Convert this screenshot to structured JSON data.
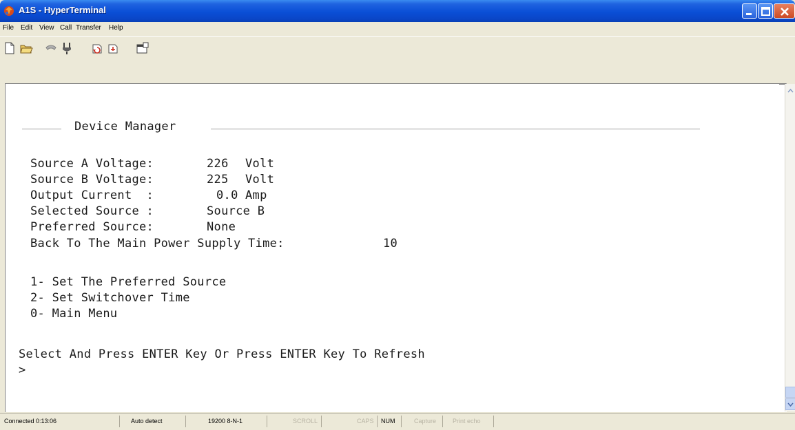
{
  "window": {
    "title": "A1S - HyperTerminal",
    "icon": "hyperterminal-app-icon"
  },
  "menu": {
    "file": "File",
    "edit": "Edit",
    "view": "View",
    "call": "Call",
    "transfer": "Transfer",
    "help": "Help"
  },
  "toolbar": {
    "icons": [
      "new-document-icon",
      "open-folder-icon",
      "connect-phone-icon",
      "disconnect-icon",
      "send-icon",
      "receive-icon",
      "properties-icon"
    ]
  },
  "terminal": {
    "header": "Device Manager",
    "source_a_label": "Source A Voltage:",
    "source_a_value": "226",
    "source_a_unit": "Volt",
    "source_b_label": "Source B Voltage:",
    "source_b_value": "225",
    "source_b_unit": "Volt",
    "output_current_label": "Output Current  :",
    "output_current_value": "0.0",
    "output_current_unit": "Amp",
    "selected_source_label": "Selected Source :",
    "selected_source_value": "Source B",
    "preferred_source_label": "Preferred Source:",
    "preferred_source_value": "None",
    "back_time_label": "Back To The Main Power Supply Time:",
    "back_time_value": "10",
    "option_1": "1- Set The Preferred Source",
    "option_2": "2- Set Switchover Time",
    "option_0": "0- Main Menu",
    "prompt_text": "Select And Press ENTER Key Or Press ENTER Key To Refresh",
    "prompt_cursor": ">"
  },
  "status": {
    "connected": "Connected 0:13:06",
    "detect": "Auto detect",
    "baud": "19200 8-N-1",
    "scroll": "SCROLL",
    "caps": "CAPS",
    "num": "NUM",
    "capture": "Capture",
    "print_echo": "Print echo"
  },
  "colors": {
    "titlebar": "#0a4fd6",
    "chrome": "#ece9d8",
    "terminal_bg": "#ffffff",
    "terminal_text": "#1a1a1a"
  }
}
